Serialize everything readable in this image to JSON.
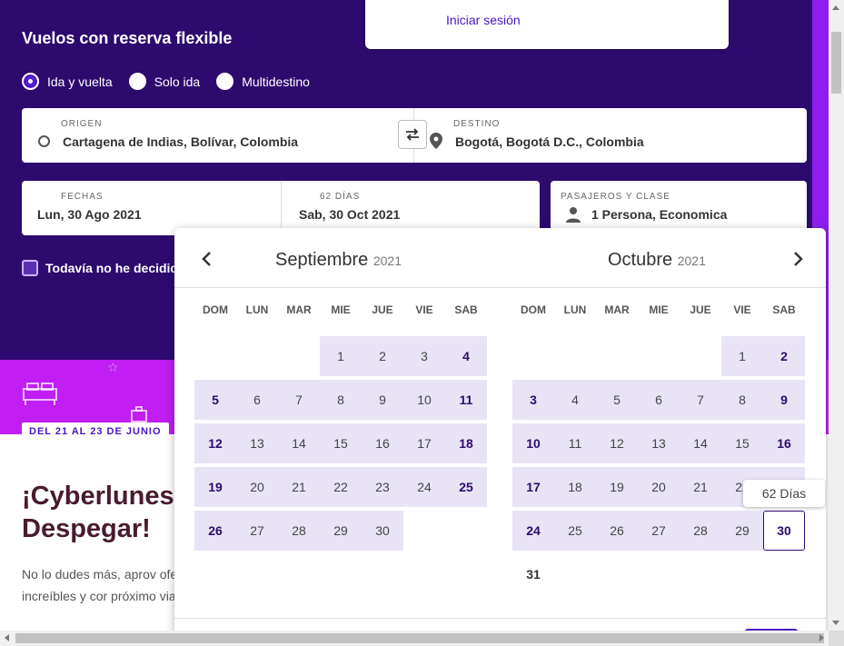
{
  "header": {
    "title": "Vuelos con reserva flexible",
    "login_link": "Iniciar sesión"
  },
  "trip_types": [
    {
      "label": "Ida y vuelta",
      "checked": true
    },
    {
      "label": "Solo ida",
      "checked": false
    },
    {
      "label": "Multidestino",
      "checked": false
    }
  ],
  "origin": {
    "label": "ORIGEN",
    "value": "Cartagena de Indias, Bolívar, Colombia"
  },
  "destination": {
    "label": "DESTINO",
    "value": "Bogotá, Bogotá D.C., Colombia"
  },
  "dates": {
    "label": "FECHAS",
    "departure": "Lun, 30 Ago 2021",
    "duration_label": "62 DÍAS",
    "return": "Sab, 30 Oct 2021"
  },
  "passengers": {
    "label": "PASAJEROS Y CLASE",
    "value": "1 Persona, Economica"
  },
  "undecided_checkbox": "Todavía no he decidido",
  "promo": {
    "tag": "DEL 21 AL 23 DE JUNIO",
    "title": "¡Cyberlunes Despegar!",
    "text": "No lo dudes más, aprov ofertas increíbles y cor próximo viaje."
  },
  "calendar": {
    "weekdays": [
      "DOM",
      "LUN",
      "MAR",
      "MIE",
      "JUE",
      "VIE",
      "SAB"
    ],
    "months": [
      {
        "name": "Septiembre",
        "year": "2021",
        "first_weekday": 3,
        "days": 30
      },
      {
        "name": "Octubre",
        "year": "2021",
        "first_weekday": 5,
        "days": 31
      }
    ],
    "selected_end": {
      "month": 1,
      "day": 30
    },
    "tooltip": "62 Días"
  },
  "colors": {
    "hero": "#2d0a6e",
    "accent": "#4b14c8",
    "promo_band": "#c01ef2",
    "range": "#e8e4f5"
  }
}
